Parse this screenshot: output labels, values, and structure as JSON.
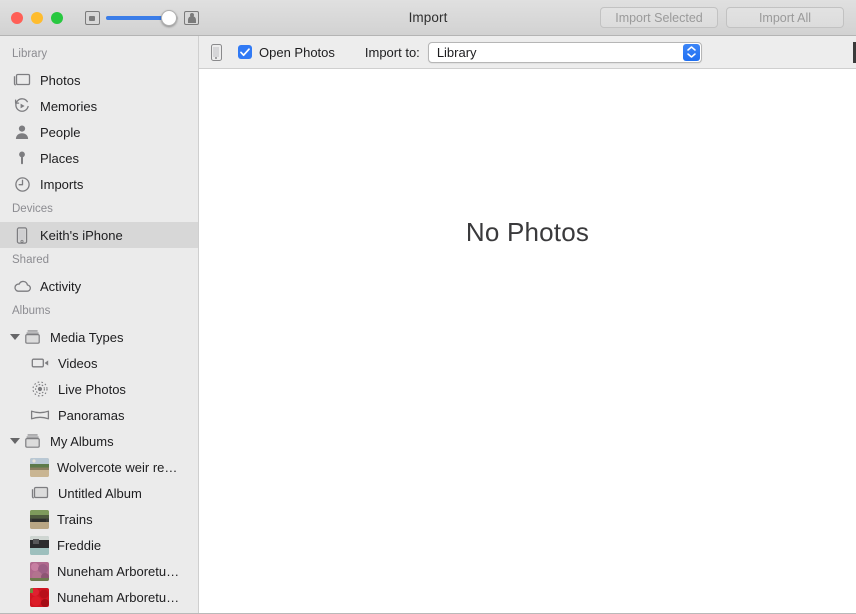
{
  "window": {
    "title": "Import",
    "traffic_lights": [
      {
        "name": "close",
        "color": "#ff5f57"
      },
      {
        "name": "minimize",
        "color": "#febc2e"
      },
      {
        "name": "zoom",
        "color": "#28c840"
      }
    ],
    "buttons": {
      "import_selected": "Import Selected",
      "import_all": "Import All"
    },
    "zoom_slider": {
      "value": 78,
      "min_icon": "small-thumbnail-icon",
      "max_icon": "large-thumbnail-icon"
    }
  },
  "import_bar": {
    "device_icon": "iphone-icon",
    "open_photos_label": "Open Photos",
    "open_photos_checked": true,
    "import_to_label": "Import to:",
    "import_to_value": "Library"
  },
  "content": {
    "empty_message": "No Photos"
  },
  "sidebar": {
    "sections": [
      {
        "header": "Library",
        "items": [
          {
            "label": "Photos",
            "icon": "photos-icon",
            "selected": false
          },
          {
            "label": "Memories",
            "icon": "memories-icon",
            "selected": false
          },
          {
            "label": "People",
            "icon": "people-icon",
            "selected": false
          },
          {
            "label": "Places",
            "icon": "places-icon",
            "selected": false
          },
          {
            "label": "Imports",
            "icon": "imports-icon",
            "selected": false
          }
        ]
      },
      {
        "header": "Devices",
        "items": [
          {
            "label": "Keith's iPhone",
            "icon": "iphone-icon",
            "selected": true
          }
        ]
      },
      {
        "header": "Shared",
        "items": [
          {
            "label": "Activity",
            "icon": "cloud-icon",
            "selected": false
          }
        ]
      },
      {
        "header": "Albums",
        "items": [
          {
            "label": "Media Types",
            "icon": "albums-stack-icon",
            "group": true,
            "expanded": true
          },
          {
            "label": "Videos",
            "icon": "video-icon",
            "indent": true
          },
          {
            "label": "Live Photos",
            "icon": "live-photos-icon",
            "indent": true
          },
          {
            "label": "Panoramas",
            "icon": "panorama-icon",
            "indent": true
          },
          {
            "label": "My Albums",
            "icon": "albums-stack-icon",
            "group": true,
            "expanded": true
          },
          {
            "label": "Wolvercote weir re…",
            "icon": "album-thumbnail",
            "indent": true,
            "thumb": "wolvercote"
          },
          {
            "label": "Untitled Album",
            "icon": "photos-icon",
            "indent": true
          },
          {
            "label": "Trains",
            "icon": "album-thumbnail",
            "indent": true,
            "thumb": "trains"
          },
          {
            "label": "Freddie",
            "icon": "album-thumbnail",
            "indent": true,
            "thumb": "freddie"
          },
          {
            "label": "Nuneham Arboretu…",
            "icon": "album-thumbnail",
            "indent": true,
            "thumb": "nuneham1"
          },
          {
            "label": "Nuneham Arboretu…",
            "icon": "album-thumbnail",
            "indent": true,
            "thumb": "nuneham2"
          }
        ]
      }
    ]
  },
  "colors": {
    "accent": "#317af5",
    "sidebar_bg": "#ebebeb",
    "selected_row": "#d7d7d7",
    "section_header_text": "#8c8c91"
  }
}
